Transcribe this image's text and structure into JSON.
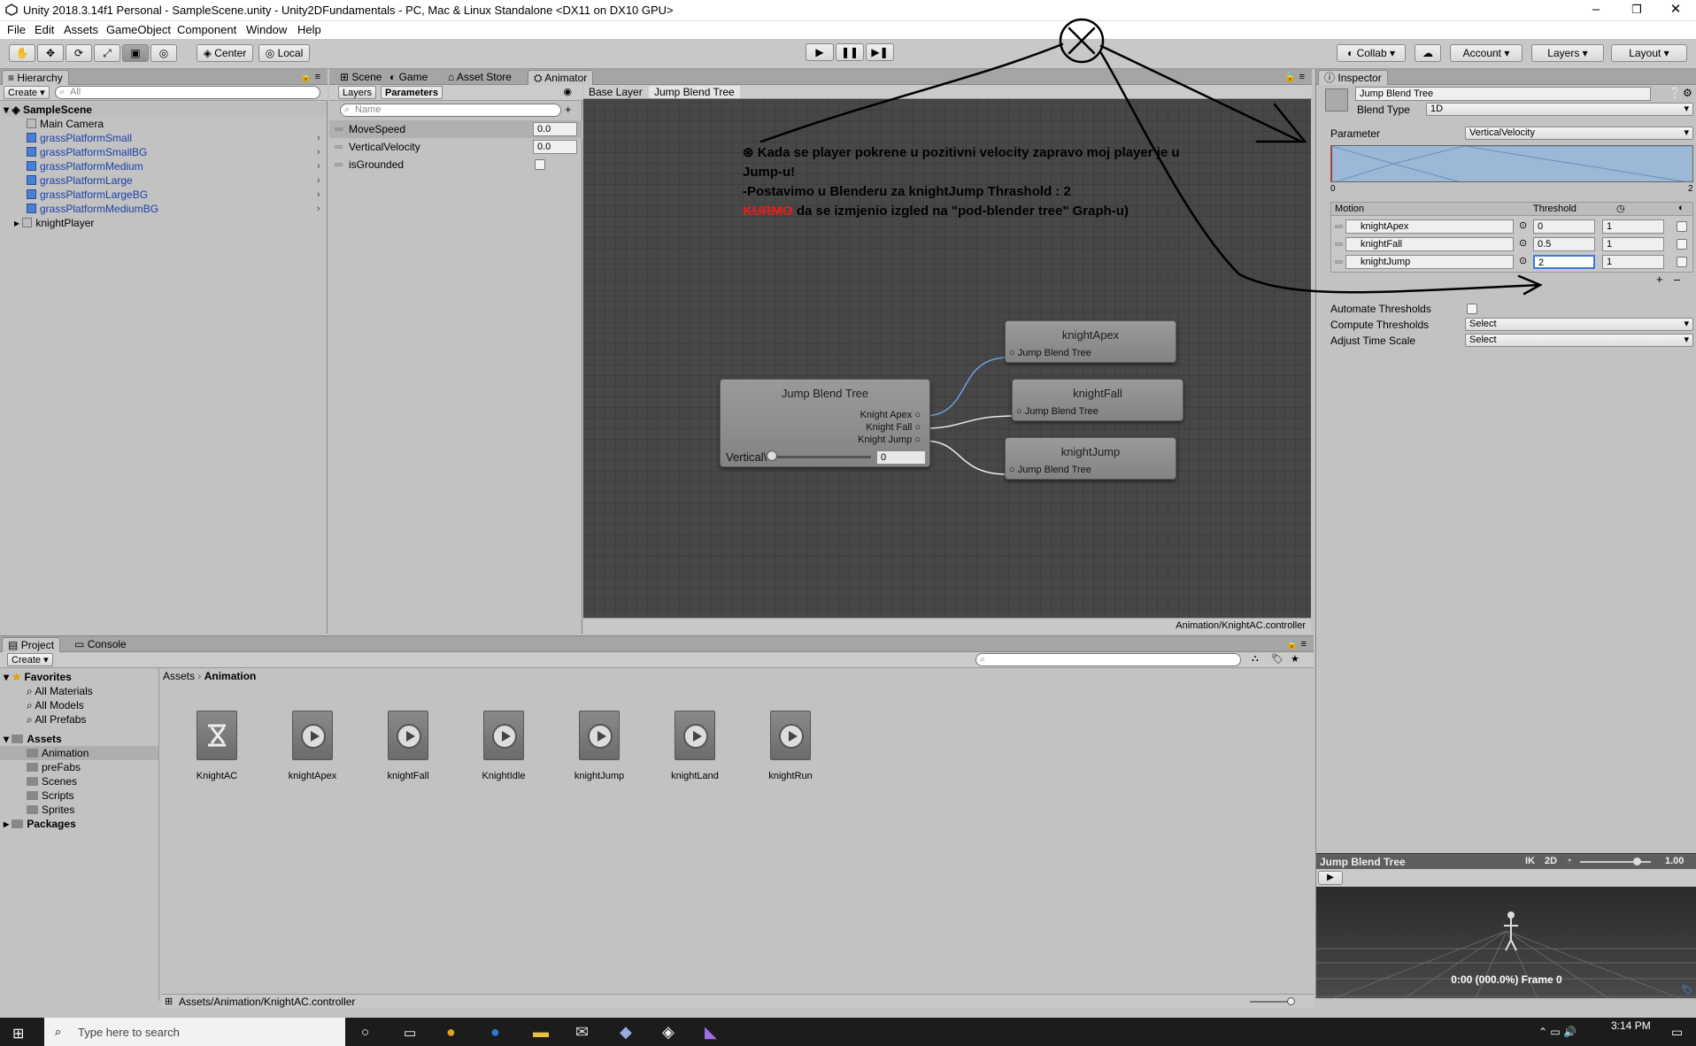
{
  "window": {
    "title": "Unity 2018.3.14f1 Personal - SampleScene.unity - Unity2DFundamentals - PC, Mac & Linux Standalone <DX11 on DX10 GPU>",
    "minimize": "–",
    "maximize": "❐",
    "close": "✕"
  },
  "menu": [
    "File",
    "Edit",
    "Assets",
    "GameObject",
    "Component",
    "Window",
    "Help"
  ],
  "toolbar": {
    "pivot": "Center",
    "space": "Local",
    "collab": "Collab",
    "account": "Account",
    "layers": "Layers",
    "layout": "Layout"
  },
  "hierarchy": {
    "tab": "Hierarchy",
    "create": "Create",
    "search_placeholder": "All",
    "scene": "SampleScene",
    "items": [
      "Main Camera",
      "grassPlatformSmall",
      "grassPlatformSmallBG",
      "grassPlatformMedium",
      "grassPlatformLarge",
      "grassPlatformLargeBG",
      "grassPlatformMediumBG",
      "knightPlayer"
    ]
  },
  "center_tabs": [
    "Scene",
    "Game",
    "Asset Store",
    "Animator"
  ],
  "animator": {
    "layers_tab": "Layers",
    "parameters_tab": "Parameters",
    "search_placeholder": "Name",
    "parameters": [
      {
        "name": "MoveSpeed",
        "value": "0.0"
      },
      {
        "name": "VerticalVelocity",
        "value": "0.0"
      },
      {
        "name": "isGrounded",
        "value": ""
      }
    ],
    "breadcrumb": [
      "Base Layer",
      "Jump Blend Tree"
    ],
    "status_path": "Animation/KnightAC.controller",
    "blend_node": {
      "title": "Jump Blend Tree",
      "ports": [
        "Knight Apex",
        "Knight Fall",
        "Knight Jump"
      ],
      "param_label": "Vertical\\",
      "param_value": "0"
    },
    "child_nodes": [
      {
        "title": "knightApex",
        "port": "Jump Blend Tree"
      },
      {
        "title": "knightFall",
        "port": "Jump Blend Tree"
      },
      {
        "title": "knightJump",
        "port": "Jump Blend Tree"
      }
    ],
    "note": {
      "line1": "Kada se player pokrene u pozitivni velocity zapravo moj player je u",
      "line2": "Jump-u!",
      "line3": "-Postavimo u Blenderu za knightJump Thrashold : 2",
      "crossed": "KURMO",
      "line4": " da se izmjenio izgled na \"pod-blender tree\" Graph-u)"
    }
  },
  "inspector": {
    "tab": "Inspector",
    "name": "Jump Blend Tree",
    "blend_type_label": "Blend Type",
    "blend_type": "1D",
    "parameter_label": "Parameter",
    "parameter": "VerticalVelocity",
    "range_min": "0",
    "range_max": "2",
    "motion_header": "Motion",
    "threshold_header": "Threshold",
    "motions": [
      {
        "name": "knightApex",
        "threshold": "0",
        "speed": "1"
      },
      {
        "name": "knightFall",
        "threshold": "0.5",
        "speed": "1"
      },
      {
        "name": "knightJump",
        "threshold": "2",
        "speed": "1"
      }
    ],
    "add": "+",
    "remove": "–",
    "automate_label": "Automate Thresholds",
    "compute_label": "Compute Thresholds",
    "compute_value": "Select",
    "adjust_label": "Adjust Time Scale",
    "adjust_value": "Select"
  },
  "preview": {
    "title": "Jump Blend Tree",
    "ik": "IK",
    "mode": "2D",
    "speed": "1.00",
    "time": "0:00 (000.0%) Frame 0"
  },
  "project": {
    "tabs": [
      "Project",
      "Console"
    ],
    "create": "Create",
    "favorites": "Favorites",
    "fav_items": [
      "All Materials",
      "All Models",
      "All Prefabs"
    ],
    "assets": "Assets",
    "folders": [
      "Animation",
      "preFabs",
      "Scenes",
      "Scripts",
      "Sprites"
    ],
    "packages": "Packages",
    "breadcrumb": [
      "Assets",
      "Animation"
    ],
    "files": [
      "KnightAC",
      "knightApex",
      "knightFall",
      "KnightIdle",
      "knightJump",
      "knightLand",
      "knightRun"
    ],
    "status_path": "Assets/Animation/KnightAC.controller"
  },
  "taskbar": {
    "search_placeholder": "Type here to search",
    "time": "3:14 PM"
  },
  "colors": {
    "graph_bg": "#474747",
    "accent_blue": "#1a3fa8",
    "red_scribble": "#e0201a"
  }
}
